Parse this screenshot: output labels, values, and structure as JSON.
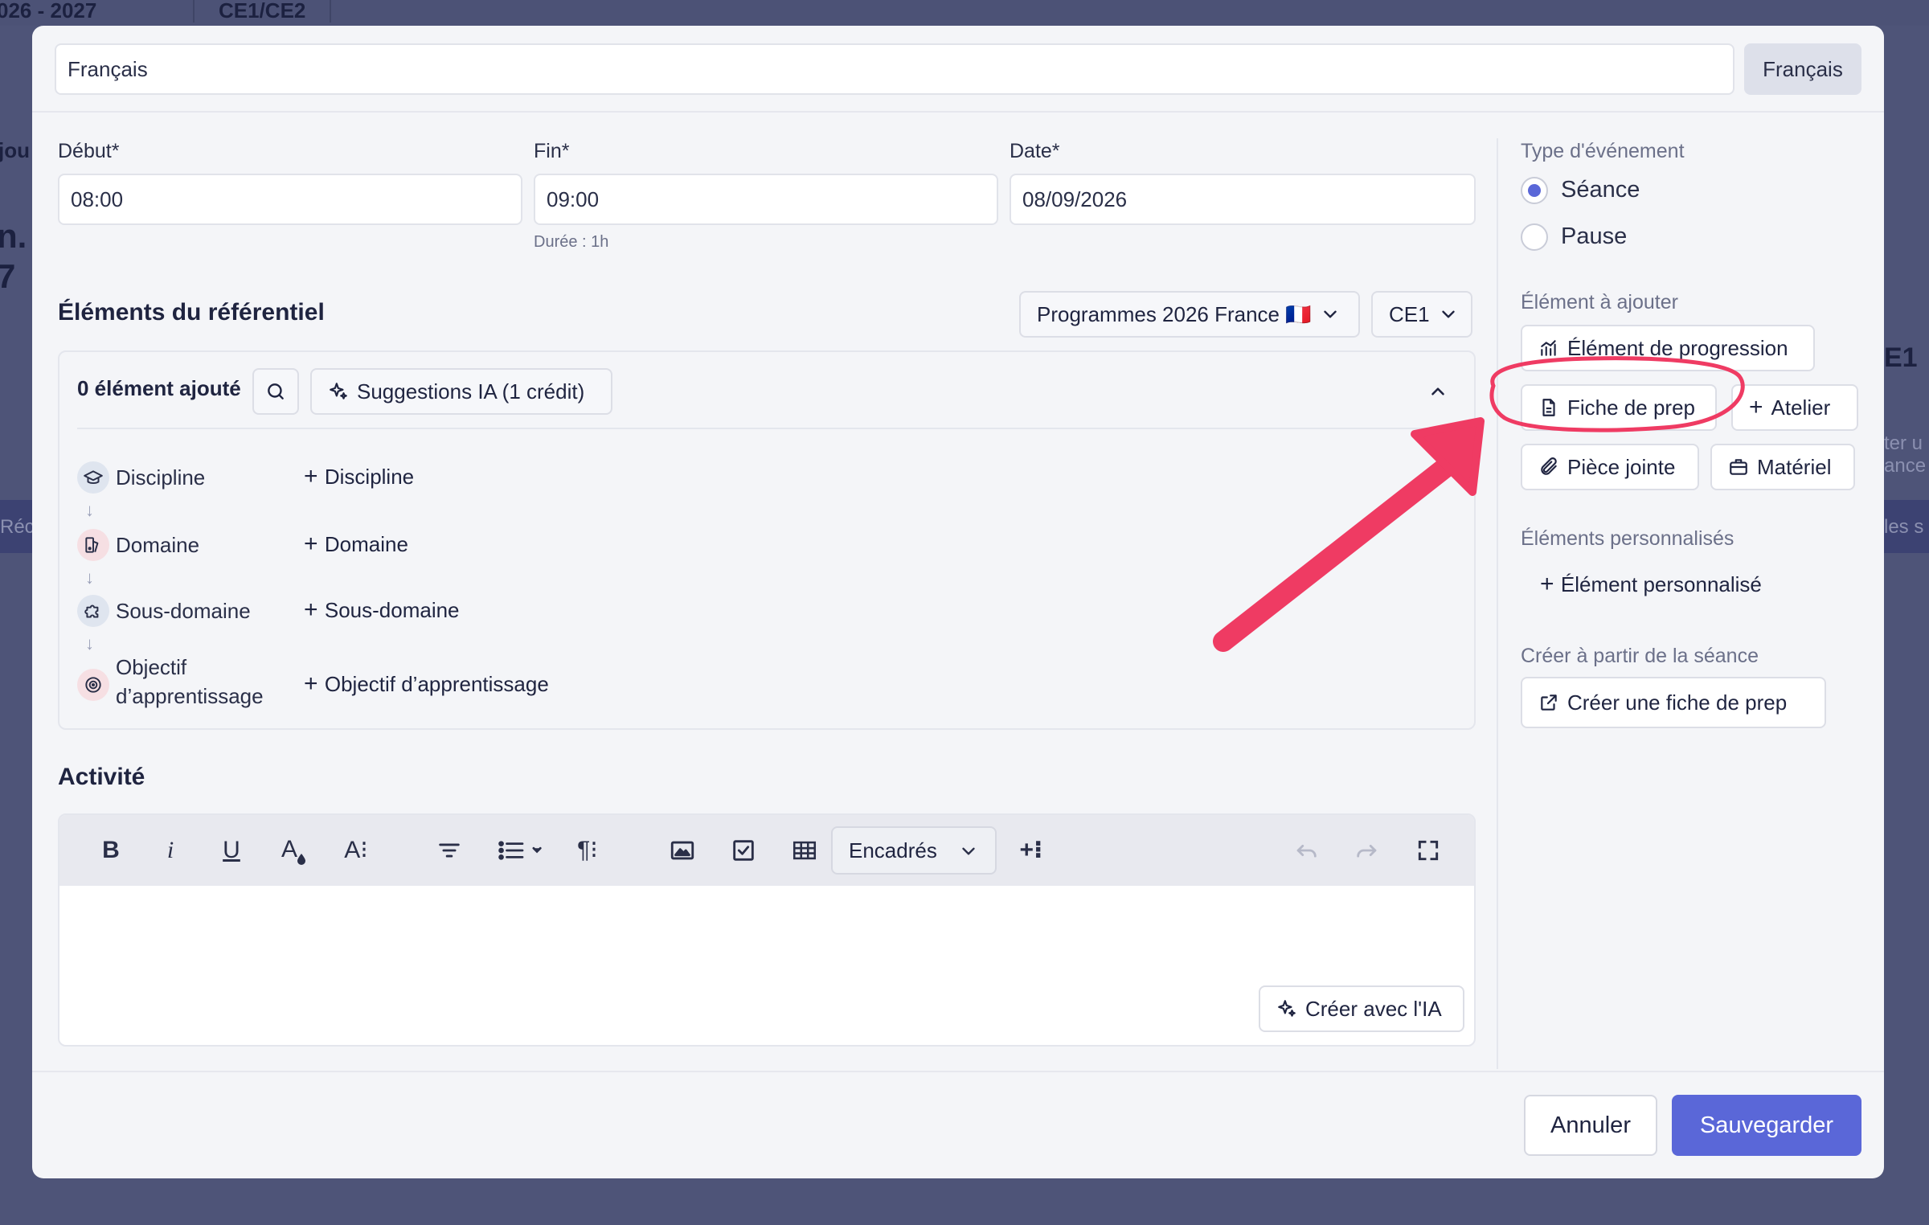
{
  "background": {
    "year": "026 - 2027",
    "class": "CE1/CE2",
    "left_text_1": "jou",
    "left_text_2": "n.",
    "left_text_3": "7",
    "left_text_4": "Réc",
    "right_text_1": "E1",
    "right_text_2": "ter u",
    "right_text_3": "ance",
    "right_text_4": "les s"
  },
  "header": {
    "title_value": "Français",
    "subject_button": "Français"
  },
  "timing": {
    "start_label": "Début*",
    "start_value": "08:00",
    "end_label": "Fin*",
    "end_value": "09:00",
    "duration": "Durée : 1h",
    "date_label": "Date*",
    "date_value": "08/09/2026"
  },
  "referentiel": {
    "title": "Éléments du référentiel",
    "program_select": "Programmes 2026 France 🇫🇷",
    "level_select": "CE1",
    "count": "0 élément ajouté",
    "suggestions": "Suggestions IA (1 crédit)",
    "levels": [
      {
        "label": "Discipline",
        "add": "Discipline",
        "icon": "graduation-cap-icon",
        "color": "#dfe5ef"
      },
      {
        "label": "Domaine",
        "add": "Domaine",
        "icon": "palette-icon",
        "color": "#f6dfe3"
      },
      {
        "label": "Sous-domaine",
        "add": "Sous-domaine",
        "icon": "puzzle-icon",
        "color": "#dfe5ef"
      },
      {
        "label_line1": "Objectif",
        "label_line2": "d’apprentissage",
        "add": "Objectif d’apprentissage",
        "icon": "target-icon",
        "color": "#f6dfe3"
      }
    ]
  },
  "activity": {
    "title": "Activité",
    "encadres": "Encadrés",
    "ai_button": "Créer avec l'IA"
  },
  "sidebar": {
    "event_type_label": "Type d'événement",
    "event_types": [
      "Séance",
      "Pause"
    ],
    "selected_event_type": "Séance",
    "add_label": "Élément à ajouter",
    "add_progression": "Élément de progression",
    "add_fiche": "Fiche de prep",
    "add_atelier": "Atelier",
    "add_piece": "Pièce jointe",
    "add_materiel": "Matériel",
    "custom_label": "Éléments personnalisés",
    "custom_add": "Élément personnalisé",
    "create_label": "Créer à partir de la séance",
    "create_button": "Créer une fiche de prep"
  },
  "footer": {
    "cancel": "Annuler",
    "save": "Sauvegarder"
  },
  "colors": {
    "accent": "#5a67d8",
    "annotation": "#ef3b63"
  }
}
